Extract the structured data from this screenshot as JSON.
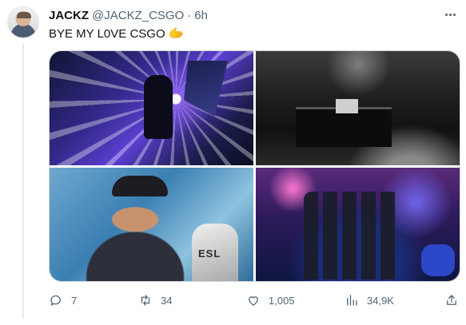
{
  "author": {
    "name": "JACKZ",
    "handle": "@JACKZ_CSGO",
    "separator": "·",
    "time": "6h"
  },
  "tweet": {
    "text": "BYE MY L0VE CSGO",
    "emoji": "🫱"
  },
  "media": {
    "image3_logo_text": "ESL"
  },
  "actions": {
    "replies": "7",
    "retweets": "34",
    "likes": "1,005",
    "views": "34,9K"
  },
  "icons": [
    "more-icon",
    "reply-icon",
    "retweet-icon",
    "like-icon",
    "views-icon",
    "share-icon"
  ],
  "colors": {
    "secondary_text": "#536471",
    "border": "#cfd9de"
  }
}
